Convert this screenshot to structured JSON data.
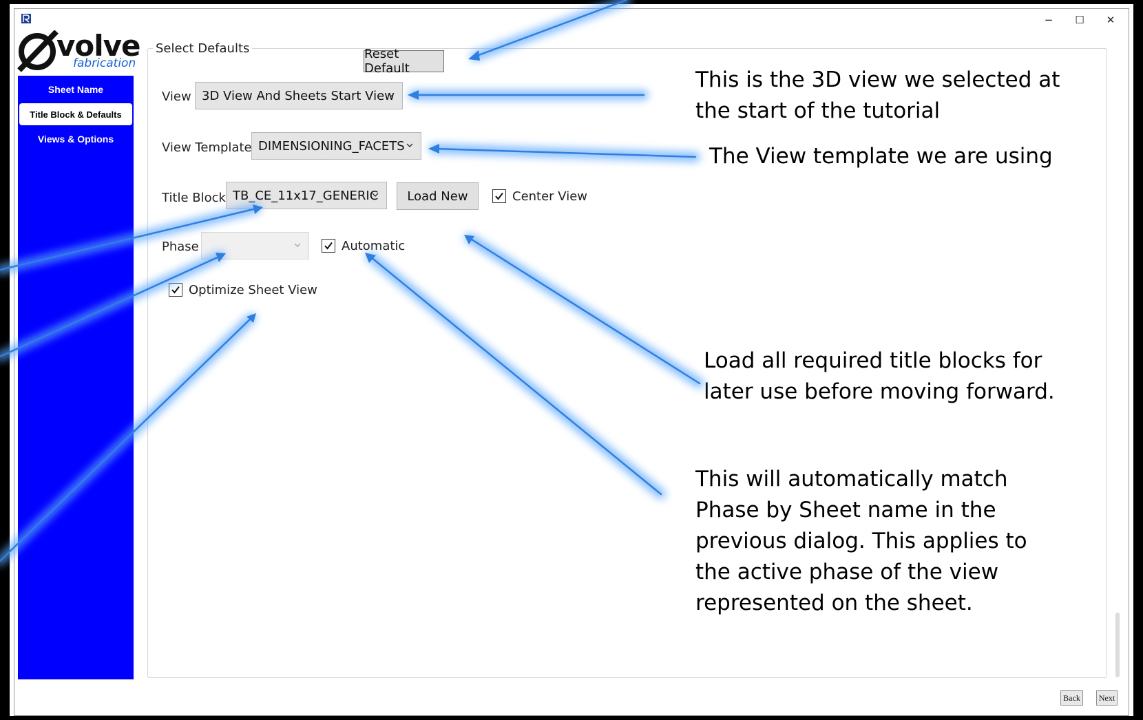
{
  "window": {
    "minimize_label": "−",
    "maximize_label": "☐",
    "close_label": "✕",
    "app_icon": "revit-icon"
  },
  "logo": {
    "word": "volve",
    "sub": "fabrication"
  },
  "sidebar": {
    "items": [
      {
        "label": "Sheet Name"
      },
      {
        "label": "Title Block & Defaults"
      },
      {
        "label": "Views & Options"
      }
    ]
  },
  "form": {
    "group_title": "Select Defaults",
    "reset_label": "Reset Default",
    "view_label": "View",
    "view_value": "3D View And Sheets Start View",
    "template_label": "View Template",
    "template_value": "DIMENSIONING_FACETS",
    "title_block_label": "Title Block",
    "title_block_value": "TB_CE_11x17_GENERIC",
    "load_new_label": "Load New",
    "center_view_label": "Center View",
    "center_view_checked": true,
    "phase_label": "Phase",
    "phase_value": "",
    "automatic_label": "Automatic",
    "automatic_checked": true,
    "optimize_label": "Optimize Sheet View",
    "optimize_checked": true
  },
  "footer": {
    "back_label": "Back",
    "next_label": "Next"
  },
  "annotations": {
    "view": [
      "This is the 3D view  we selected at",
      "the start of the tutorial"
    ],
    "template": [
      "The View template we are using"
    ],
    "load": [
      "Load all required title blocks for",
      "later use before moving forward."
    ],
    "phase": [
      "This will automatically match",
      "Phase by Sheet name in the",
      "previous dialog. This applies to",
      "the active phase of the view",
      "represented on the sheet."
    ]
  },
  "colors": {
    "sidebar": "#0000ff",
    "arrow": "#2f7fe0",
    "arrow_glow": "#5aa6ff"
  }
}
